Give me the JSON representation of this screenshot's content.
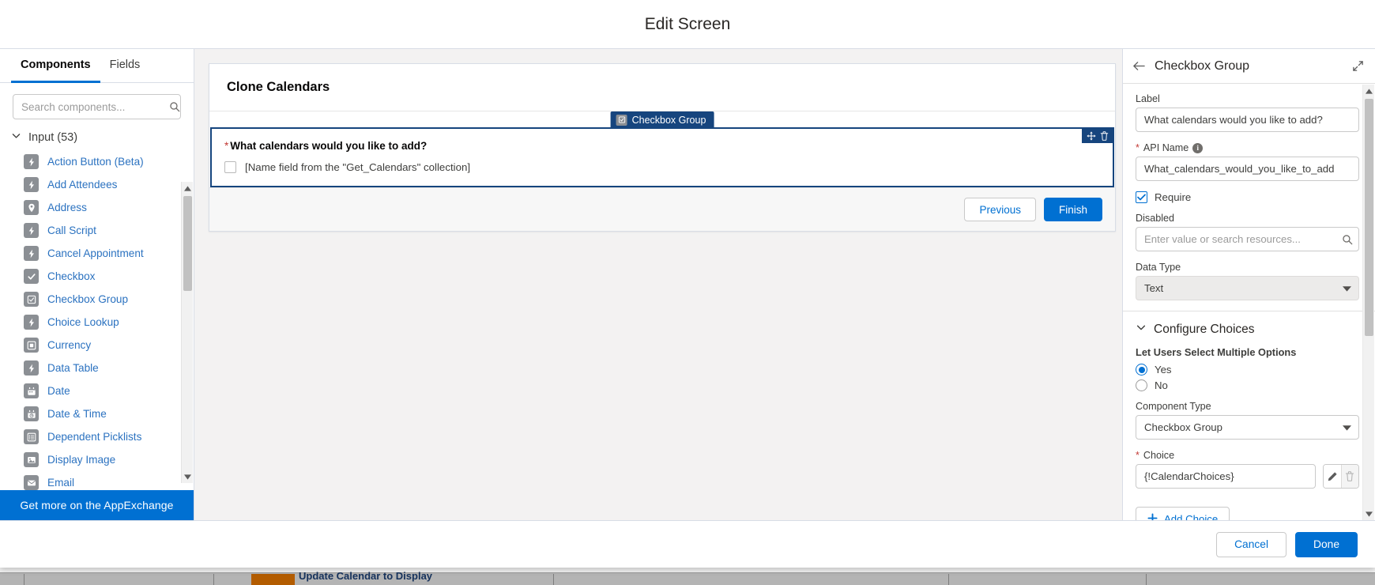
{
  "modal": {
    "title": "Edit Screen",
    "footer": {
      "cancel_label": "Cancel",
      "done_label": "Done"
    }
  },
  "background": {
    "partial_text": "Update Calendar to Display"
  },
  "left_panel": {
    "tabs": [
      {
        "label": "Components",
        "active": true
      },
      {
        "label": "Fields",
        "active": false
      }
    ],
    "search": {
      "placeholder": "Search components...",
      "value": "",
      "icon": "search-icon"
    },
    "group": {
      "label": "Input (53)",
      "icon": "chevron-down-icon",
      "expanded": true
    },
    "components": [
      {
        "label": "Action Button (Beta)",
        "icon": "lightning-icon"
      },
      {
        "label": "Add Attendees",
        "icon": "lightning-icon"
      },
      {
        "label": "Address",
        "icon": "location-pin-icon"
      },
      {
        "label": "Call Script",
        "icon": "lightning-icon"
      },
      {
        "label": "Cancel Appointment",
        "icon": "lightning-icon"
      },
      {
        "label": "Checkbox",
        "icon": "check-icon"
      },
      {
        "label": "Checkbox Group",
        "icon": "checkbox-group-icon"
      },
      {
        "label": "Choice Lookup",
        "icon": "lightning-icon"
      },
      {
        "label": "Currency",
        "icon": "currency-icon"
      },
      {
        "label": "Data Table",
        "icon": "lightning-icon"
      },
      {
        "label": "Date",
        "icon": "calendar-icon"
      },
      {
        "label": "Date & Time",
        "icon": "calendar-clock-icon"
      },
      {
        "label": "Dependent Picklists",
        "icon": "list-icon"
      },
      {
        "label": "Display Image",
        "icon": "image-icon"
      },
      {
        "label": "Email",
        "icon": "envelope-icon"
      }
    ],
    "appexchange_label": "Get more on the AppExchange"
  },
  "canvas": {
    "screen_title": "Clone Calendars",
    "selected_badge": {
      "label": "Checkbox Group",
      "icon": "checkbox-group-icon"
    },
    "component_actions": [
      {
        "name": "drag-handle-icon"
      },
      {
        "name": "delete-icon"
      }
    ],
    "field": {
      "required_marker": "*",
      "label": "What calendars would you like to add?",
      "choice_text": "[Name field from the \"Get_Calendars\" collection]"
    },
    "nav_buttons": {
      "previous_label": "Previous",
      "finish_label": "Finish"
    }
  },
  "right_panel": {
    "header": {
      "title": "Checkbox Group",
      "back_icon": "arrow-left-icon",
      "expand_icon": "expand-icon"
    },
    "label_field": {
      "label": "Label",
      "value": "What calendars would you like to add?"
    },
    "api_name_field": {
      "label": "API Name",
      "required_marker": "*",
      "info_icon": "info-icon",
      "value": "What_calendars_would_you_like_to_add"
    },
    "require_checkbox": {
      "label": "Require",
      "checked": true
    },
    "disabled_field": {
      "label": "Disabled",
      "placeholder": "Enter value or search resources...",
      "value": "",
      "icon": "search-icon"
    },
    "data_type_field": {
      "label": "Data Type",
      "value": "Text",
      "disabled": true
    },
    "configure_choices": {
      "section_title": "Configure Choices",
      "expanded": true,
      "multi_select": {
        "group_title": "Let Users Select Multiple Options",
        "options": [
          {
            "label": "Yes",
            "selected": true
          },
          {
            "label": "No",
            "selected": false
          }
        ]
      },
      "component_type": {
        "label": "Component Type",
        "value": "Checkbox Group"
      },
      "choice": {
        "label": "Choice",
        "required_marker": "*",
        "value": "{!CalendarChoices}",
        "edit_icon": "pencil-icon",
        "delete_icon": "trash-icon"
      },
      "add_choice_label": "Add Choice"
    }
  },
  "colors": {
    "brand_blue": "#0070d2",
    "selection_navy": "#16457e",
    "link_blue": "#2b72c0",
    "required_red": "#c23934",
    "icon_gray": "#8b8f94"
  }
}
